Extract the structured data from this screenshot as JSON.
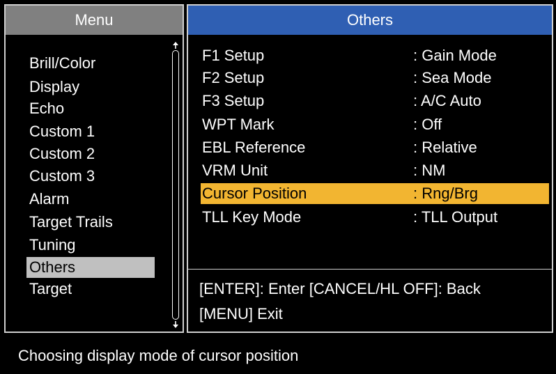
{
  "menu": {
    "title": "Menu",
    "items": [
      {
        "label": "Brill/Color"
      },
      {
        "label": "Display"
      },
      {
        "label": "Echo"
      },
      {
        "label": "Custom 1"
      },
      {
        "label": "Custom 2"
      },
      {
        "label": "Custom 3"
      },
      {
        "label": "Alarm"
      },
      {
        "label": "Target Trails"
      },
      {
        "label": "Tuning"
      },
      {
        "label": "Others"
      },
      {
        "label": "Target"
      }
    ],
    "selected_label": "Others"
  },
  "others": {
    "title": "Others",
    "settings": [
      {
        "label": "F1 Setup",
        "value": ": Gain Mode"
      },
      {
        "label": "F2 Setup",
        "value": ": Sea Mode"
      },
      {
        "label": "F3 Setup",
        "value": ": A/C Auto"
      },
      {
        "label": "WPT Mark",
        "value": ": Off"
      },
      {
        "label": "EBL Reference",
        "value": ": Relative"
      },
      {
        "label": "VRM Unit",
        "value": ": NM"
      },
      {
        "label": "Cursor Position",
        "value": ": Rng/Brg"
      },
      {
        "label": "TLL Key Mode",
        "value": ": TLL Output"
      }
    ],
    "help": {
      "line1": "[ENTER]: Enter [CANCEL/HL OFF]: Back",
      "line2": "[MENU] Exit"
    }
  },
  "status": {
    "text": "Choosing display mode of cursor position"
  },
  "colors": {
    "menu_header_bg": "#808080",
    "others_header_bg": "#2f5fb3",
    "highlight_bg": "#f2b531",
    "selected_menu_bg": "#c0c0c0"
  },
  "icons": {
    "scroll_up": "arrow-up-icon",
    "scroll_down": "arrow-down-icon"
  }
}
